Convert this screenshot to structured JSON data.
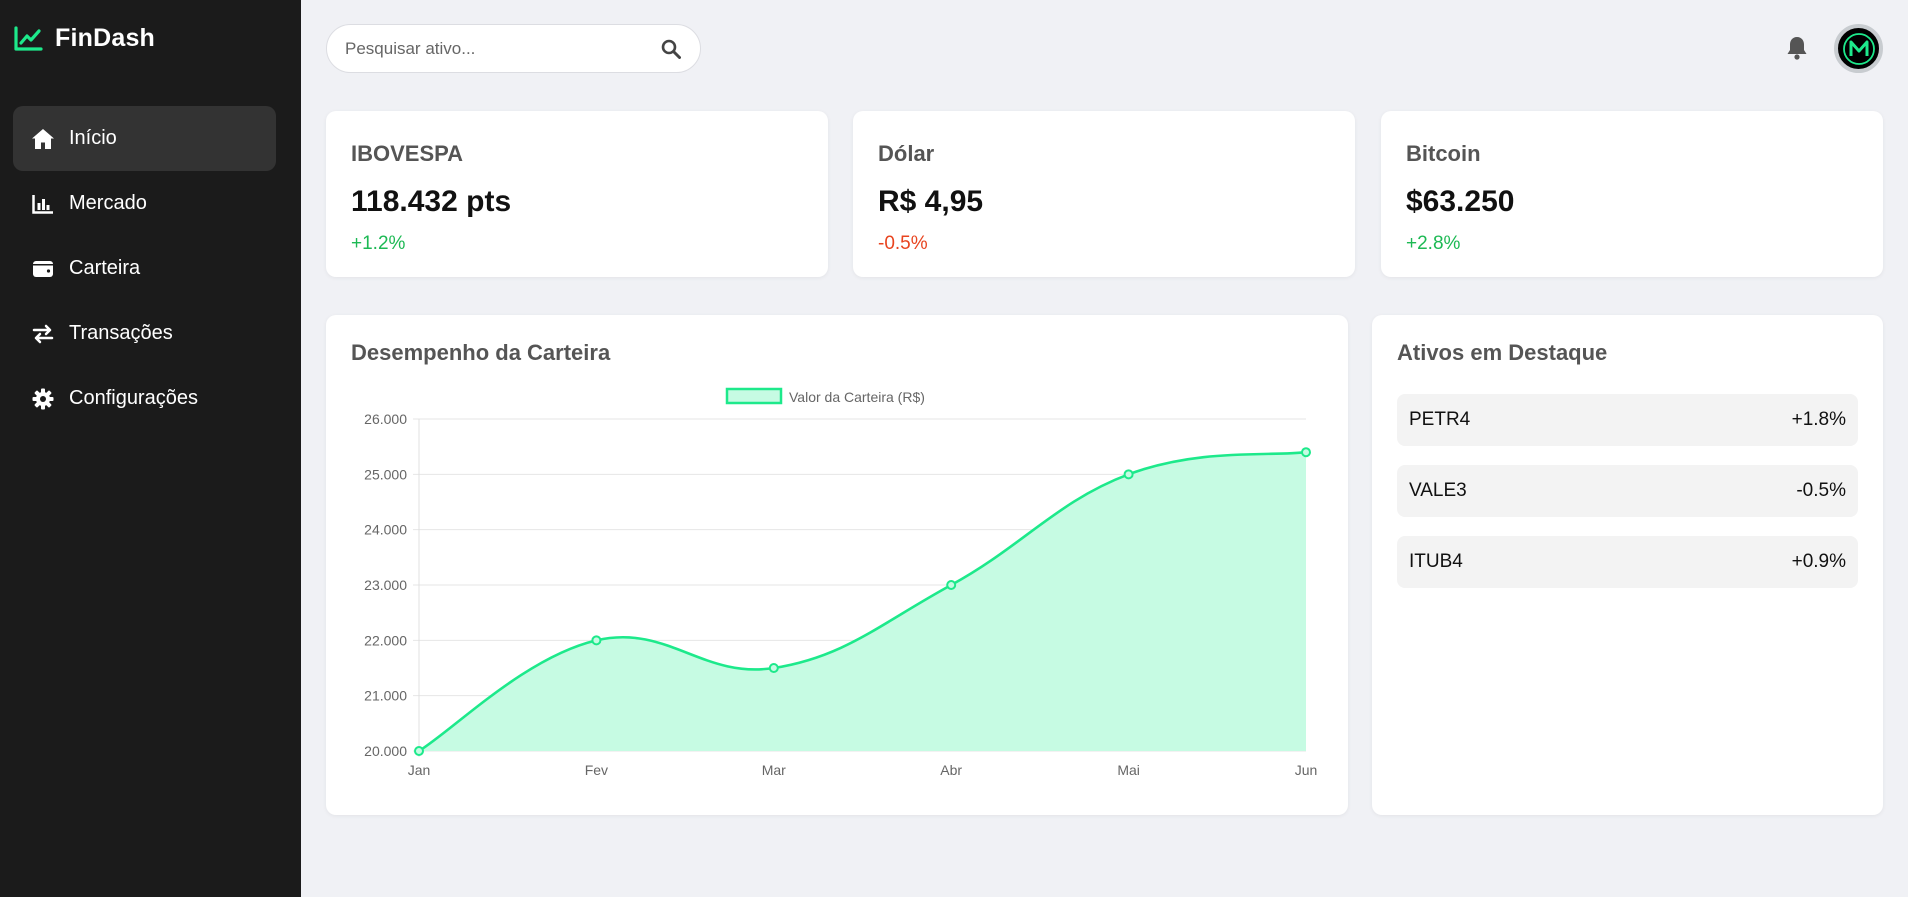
{
  "app": {
    "name": "FinDash"
  },
  "colors": {
    "accent": "#1de98b",
    "positive": "#1db954",
    "negative": "#e8441f",
    "sidebar_bg": "#1b1b1b"
  },
  "sidebar": {
    "items": [
      {
        "label": "Início",
        "icon": "home-icon",
        "active": true
      },
      {
        "label": "Mercado",
        "icon": "chart-bar-icon"
      },
      {
        "label": "Carteira",
        "icon": "wallet-icon"
      },
      {
        "label": "Transações",
        "icon": "exchange-icon"
      },
      {
        "label": "Configurações",
        "icon": "gear-icon"
      }
    ]
  },
  "search": {
    "placeholder": "Pesquisar ativo..."
  },
  "header": {
    "bell_icon": "bell-icon",
    "avatar_letter": "M"
  },
  "stats": [
    {
      "title": "IBOVESPA",
      "value": "118.432 pts",
      "change": "+1.2%"
    },
    {
      "title": "Dólar",
      "value": "R$ 4,95",
      "change": "-0.5%"
    },
    {
      "title": "Bitcoin",
      "value": "$63.250",
      "change": "+2.8%"
    }
  ],
  "portfolio": {
    "title": "Desempenho da Carteira"
  },
  "chart_data": {
    "type": "area",
    "title": "",
    "xlabel": "",
    "ylabel": "",
    "categories": [
      "Jan",
      "Fev",
      "Mar",
      "Abr",
      "Mai",
      "Jun"
    ],
    "series": [
      {
        "name": "Valor da Carteira (R$)",
        "values": [
          20000,
          22000,
          21500,
          23000,
          25000,
          25400
        ]
      }
    ],
    "ylim": [
      20000,
      26000
    ],
    "yticks": [
      "20.000",
      "21.000",
      "22.000",
      "23.000",
      "24.000",
      "25.000",
      "26.000"
    ],
    "grid": true,
    "legend": "top-center",
    "line_color": "#1de98b",
    "fill_color": "#c6fbe3"
  },
  "highlights": {
    "title": "Ativos em Destaque",
    "items": [
      {
        "ticker": "PETR4",
        "change": "+1.8%"
      },
      {
        "ticker": "VALE3",
        "change": "-0.5%"
      },
      {
        "ticker": "ITUB4",
        "change": "+0.9%"
      }
    ]
  }
}
